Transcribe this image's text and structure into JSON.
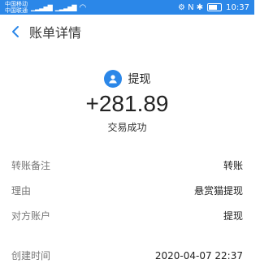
{
  "status_bar": {
    "carrier_line1": "中国移动",
    "carrier_line2": "中国联通",
    "signal1": "▁▂▃▅▇",
    "signal2": "▁▂▃▅▇",
    "wifi": "◠",
    "icons": "⚙ N ✱",
    "battery_percent": 0.7,
    "time": "10:37"
  },
  "header": {
    "back_icon": "chevron-left-icon",
    "title": "账单详情"
  },
  "summary": {
    "payee_name": "提现",
    "amount": "+281.89",
    "status": "交易成功"
  },
  "details": [
    {
      "label": "转账备注",
      "value": "转账"
    },
    {
      "label": "理由",
      "value": "悬赏猫提现"
    },
    {
      "label": "对方账户",
      "value": "提现"
    }
  ],
  "details2": [
    {
      "label": "创建时间",
      "value": "2020-04-07 22:37"
    }
  ],
  "colors": {
    "accent": "#2b87e8",
    "status_bar": "#2b87e8"
  }
}
